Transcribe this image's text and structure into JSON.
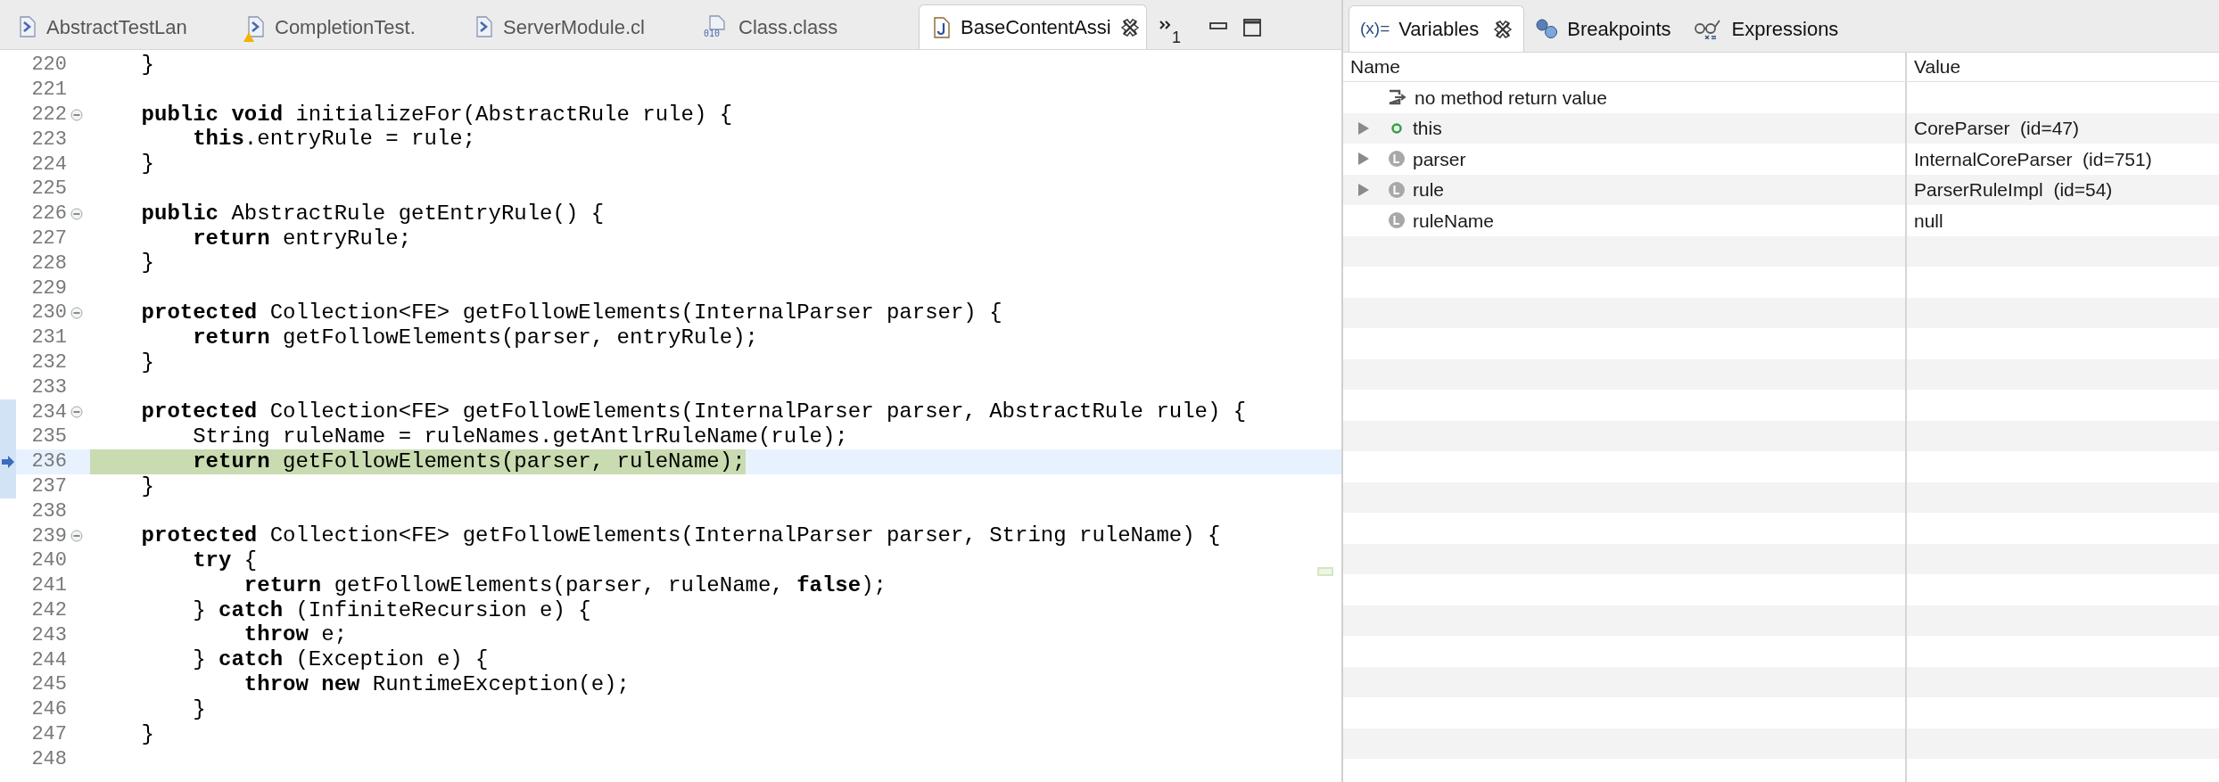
{
  "editor": {
    "tabs": [
      {
        "label": "AbstractTestLan",
        "kind": "xtend",
        "warning": false,
        "selected": false,
        "closable": false
      },
      {
        "label": "CompletionTest.",
        "kind": "xtend",
        "warning": true,
        "selected": false,
        "closable": false
      },
      {
        "label": "ServerModule.cl",
        "kind": "xtend",
        "warning": false,
        "selected": false,
        "closable": false
      },
      {
        "label": "Class.class",
        "kind": "class",
        "icon_text": "010",
        "warning": false,
        "selected": false,
        "closable": false
      },
      {
        "label": "BaseContentAssi",
        "kind": "java",
        "warning": false,
        "selected": true,
        "closable": true
      }
    ],
    "overflow_count": "1",
    "lines": [
      {
        "n": "220",
        "code": "    }",
        "fold": false,
        "frame": false,
        "current": false
      },
      {
        "n": "221",
        "fold": false,
        "frame": false,
        "current": false
      },
      {
        "n": "222",
        "code": "    **public** **void** initializeFor(AbstractRule rule) {",
        "fold": true,
        "frame": false,
        "current": false
      },
      {
        "n": "223",
        "code": "        **this**.entryRule = rule;",
        "fold": false,
        "frame": false,
        "current": false
      },
      {
        "n": "224",
        "code": "    }",
        "fold": false,
        "frame": false,
        "current": false
      },
      {
        "n": "225",
        "fold": false,
        "frame": false,
        "current": false
      },
      {
        "n": "226",
        "code": "    **public** AbstractRule getEntryRule() {",
        "fold": true,
        "frame": false,
        "current": false
      },
      {
        "n": "227",
        "code": "        **return** entryRule;",
        "fold": false,
        "frame": false,
        "current": false
      },
      {
        "n": "228",
        "code": "    }",
        "fold": false,
        "frame": false,
        "current": false
      },
      {
        "n": "229",
        "fold": false,
        "frame": false,
        "current": false
      },
      {
        "n": "230",
        "code": "    **protected** Collection<FE> getFollowElements(InternalParser parser) {",
        "fold": true,
        "frame": false,
        "current": false
      },
      {
        "n": "231",
        "code": "        **return** getFollowElements(parser, entryRule);",
        "fold": false,
        "frame": false,
        "current": false
      },
      {
        "n": "232",
        "code": "    }",
        "fold": false,
        "frame": false,
        "current": false
      },
      {
        "n": "233",
        "fold": false,
        "frame": false,
        "current": false
      },
      {
        "n": "234",
        "code": "    **protected** Collection<FE> getFollowElements(InternalParser parser, AbstractRule rule) {",
        "fold": true,
        "frame": true,
        "current": false
      },
      {
        "n": "235",
        "code": "        String ruleName = ruleNames.getAntlrRuleName(rule);",
        "fold": false,
        "frame": true,
        "current": false
      },
      {
        "n": "236",
        "code": "        **return** getFollowElements(parser, ruleName);",
        "fold": false,
        "frame": true,
        "current": true
      },
      {
        "n": "237",
        "code": "    }",
        "fold": false,
        "frame": true,
        "current": false
      },
      {
        "n": "238",
        "fold": false,
        "frame": false,
        "current": false
      },
      {
        "n": "239",
        "code": "    **protected** Collection<FE> getFollowElements(InternalParser parser, String ruleName) {",
        "fold": true,
        "frame": false,
        "current": false
      },
      {
        "n": "240",
        "code": "        **try** {",
        "fold": false,
        "frame": false,
        "current": false
      },
      {
        "n": "241",
        "code": "            **return** getFollowElements(parser, ruleName, **false**);",
        "fold": false,
        "frame": false,
        "current": false
      },
      {
        "n": "242",
        "code": "        } **catch** (InfiniteRecursion e) {",
        "fold": false,
        "frame": false,
        "current": false
      },
      {
        "n": "243",
        "code": "            **throw** e;",
        "fold": false,
        "frame": false,
        "current": false
      },
      {
        "n": "244",
        "code": "        } **catch** (Exception e) {",
        "fold": false,
        "frame": false,
        "current": false
      },
      {
        "n": "245",
        "code": "            **throw** **new** RuntimeException(e);",
        "fold": false,
        "frame": false,
        "current": false
      },
      {
        "n": "246",
        "code": "        }",
        "fold": false,
        "frame": false,
        "current": false
      },
      {
        "n": "247",
        "code": "    }",
        "fold": false,
        "frame": false,
        "current": false
      },
      {
        "n": "248",
        "fold": false,
        "frame": false,
        "current": false
      }
    ]
  },
  "debug_view": {
    "tabs": [
      {
        "label": "Variables",
        "kind": "variables",
        "icon_text": "(x)=",
        "selected": true,
        "closable": true
      },
      {
        "label": "Breakpoints",
        "kind": "breakpoints",
        "selected": false,
        "closable": false
      },
      {
        "label": "Expressions",
        "kind": "expressions",
        "selected": false,
        "closable": false
      }
    ],
    "columns": [
      "Name",
      "Value"
    ],
    "rows": [
      {
        "name": "no method return value",
        "kind": "return",
        "expandable": false
      },
      {
        "name": "this",
        "value": "CoreParser  (id=47)",
        "kind": "field",
        "expandable": true
      },
      {
        "name": "parser",
        "value": "InternalCoreParser  (id=751)",
        "kind": "local",
        "expandable": true
      },
      {
        "name": "rule",
        "value": "ParserRuleImpl  (id=54)",
        "kind": "local",
        "expandable": true
      },
      {
        "name": "ruleName",
        "value": "null",
        "kind": "local",
        "expandable": false
      }
    ]
  }
}
